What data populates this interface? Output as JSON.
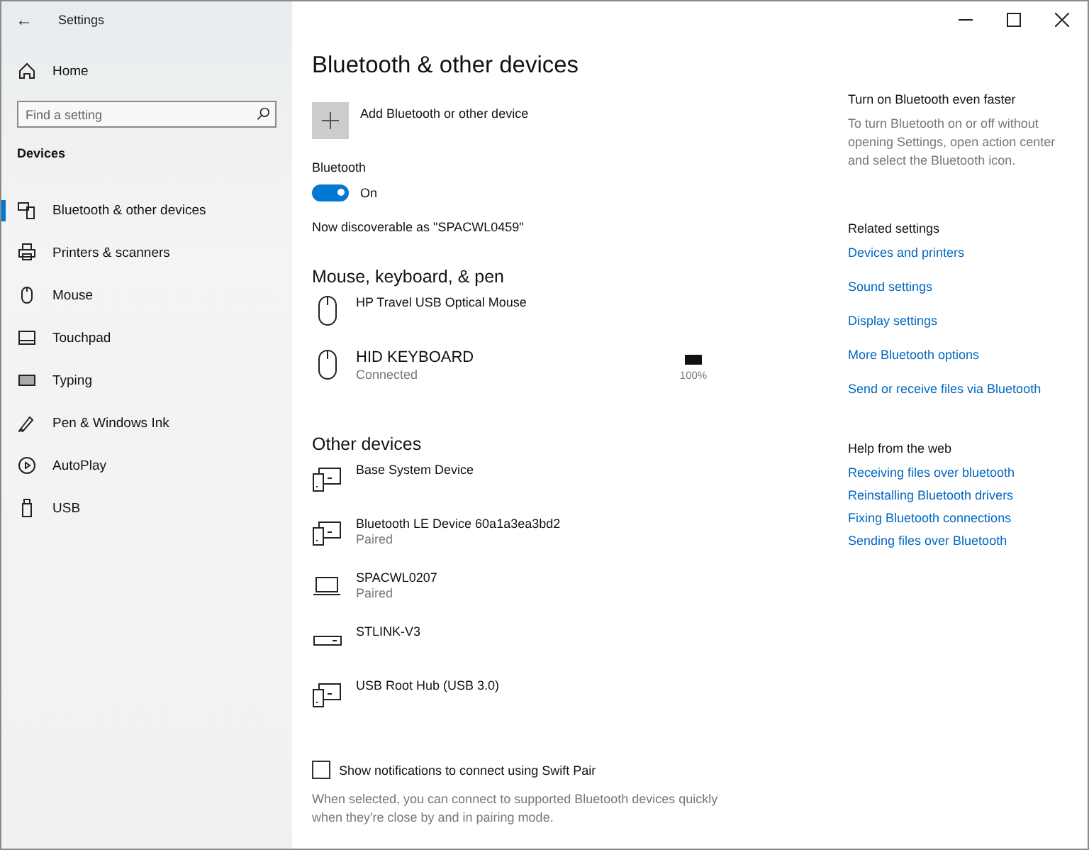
{
  "window": {
    "title": "Settings",
    "back": "←"
  },
  "sidebar": {
    "home": "Home",
    "search": {
      "placeholder": "Find a setting"
    },
    "section": "Devices",
    "items": [
      {
        "label": "Bluetooth & other devices",
        "kind": "bluetooth",
        "selected": true
      },
      {
        "label": "Printers & scanners",
        "kind": "printer",
        "selected": false
      },
      {
        "label": "Mouse",
        "kind": "mouse",
        "selected": false
      },
      {
        "label": "Touchpad",
        "kind": "touchpad",
        "selected": false
      },
      {
        "label": "Typing",
        "kind": "keyboard",
        "selected": false
      },
      {
        "label": "Pen & Windows Ink",
        "kind": "pen",
        "selected": false
      },
      {
        "label": "AutoPlay",
        "kind": "autoplay",
        "selected": false
      },
      {
        "label": "USB",
        "kind": "usb",
        "selected": false
      }
    ]
  },
  "main": {
    "title": "Bluetooth & other devices",
    "add": "Add Bluetooth or other device",
    "bluetooth": {
      "label": "Bluetooth",
      "on": true,
      "state": "On"
    },
    "discoverable": "Now discoverable as \"SPACWL0459\"",
    "groups": [
      {
        "title": "Mouse, keyboard, & pen",
        "devices": [
          {
            "name": "HP Travel USB Optical Mouse",
            "kind": "mouse"
          },
          {
            "name": "HID KEYBOARD",
            "status": "Connected",
            "kind": "mouse",
            "battery": {
              "level": 1,
              "reading": "100%"
            }
          }
        ]
      },
      {
        "title": "Other devices",
        "devices": [
          {
            "name": "Base System Device",
            "kind": "device"
          },
          {
            "name": "Bluetooth LE Device 60a1a3ea3bd2",
            "status": "Paired",
            "kind": "device"
          },
          {
            "name": "SPACWL0207",
            "status": "Paired",
            "kind": "laptop"
          },
          {
            "name": "STLINK-V3",
            "kind": "dongle"
          },
          {
            "name": "USB Root Hub (USB 3.0)",
            "kind": "device"
          }
        ]
      }
    ],
    "swift_pair": {
      "label": "Show notifications to connect using Swift Pair",
      "checked": false,
      "hint": "When selected, you can connect to supported Bluetooth devices quickly when they're close by and in pairing mode."
    }
  },
  "aside": {
    "tip_title": "Turn on Bluetooth even faster",
    "tip": "To turn Bluetooth on or off without opening Settings, open action center and select the Bluetooth icon.",
    "related_title": "Related settings",
    "related": [
      "Devices and printers",
      "Sound settings",
      "Display settings",
      "More Bluetooth options",
      "Send or receive files via Bluetooth"
    ],
    "help_title": "Help from the web",
    "help": [
      "Receiving files over bluetooth",
      "Reinstalling Bluetooth drivers",
      "Fixing Bluetooth connections",
      "Sending files over Bluetooth"
    ]
  }
}
